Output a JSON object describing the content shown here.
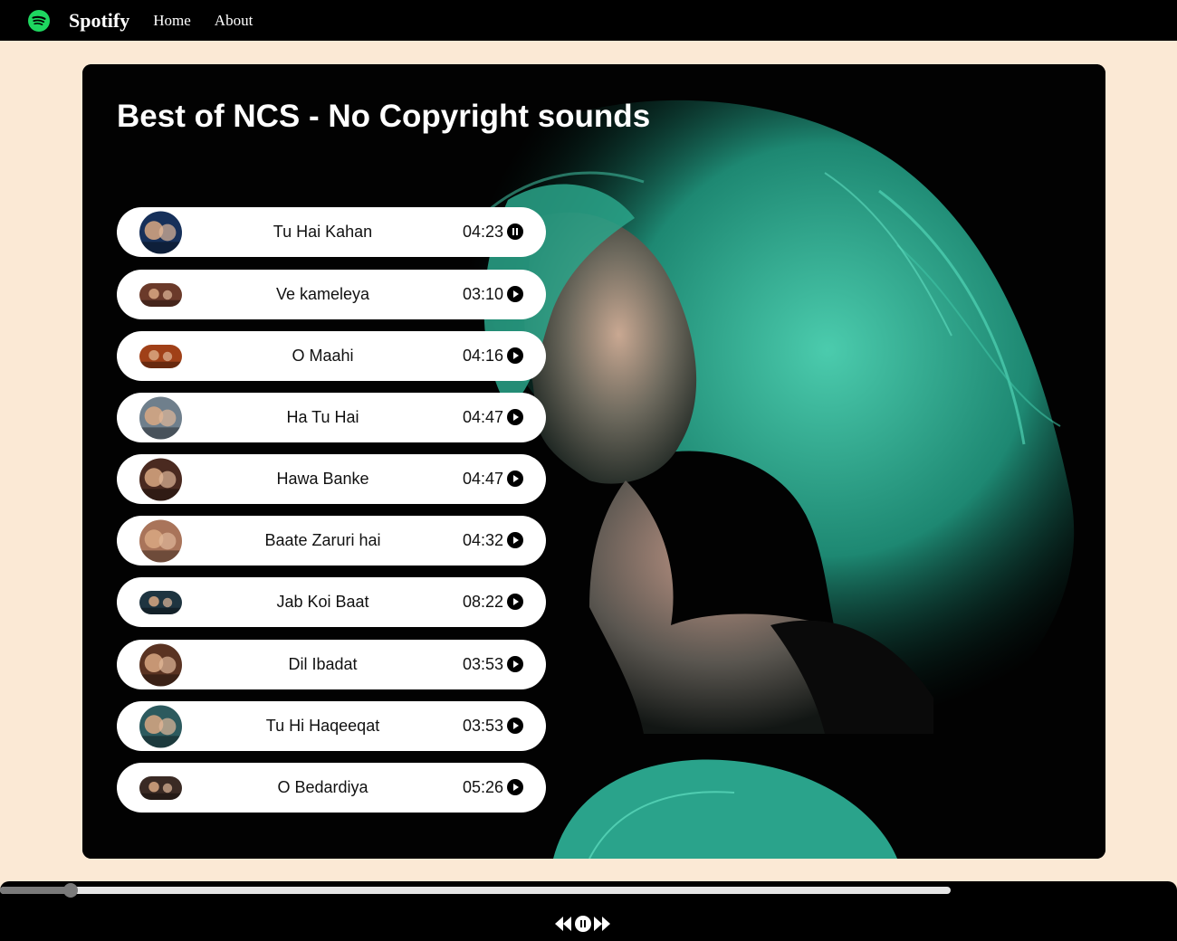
{
  "nav": {
    "brand": "Spotify",
    "logo_icon": "spotify-logo-icon",
    "links": [
      "Home",
      "About"
    ]
  },
  "playlist": {
    "title": "Best of NCS - No Copyright sounds",
    "background_icon": "green-hair-woman-illustration"
  },
  "songs": [
    {
      "name": "Tu Hai Kahan",
      "duration": "04:23",
      "state": "playing",
      "cover_color": "#16305a"
    },
    {
      "name": "Ve kameleya",
      "duration": "03:10",
      "state": "paused",
      "cover_color": "#6b3a2a"
    },
    {
      "name": "O Maahi",
      "duration": "04:16",
      "state": "paused",
      "cover_color": "#a04018"
    },
    {
      "name": "Ha Tu Hai",
      "duration": "04:47",
      "state": "paused",
      "cover_color": "#6f7f8c"
    },
    {
      "name": "Hawa Banke",
      "duration": "04:47",
      "state": "paused",
      "cover_color": "#4a2a20"
    },
    {
      "name": "Baate Zaruri hai",
      "duration": "04:32",
      "state": "paused",
      "cover_color": "#a9745a"
    },
    {
      "name": "Jab Koi Baat",
      "duration": "08:22",
      "state": "paused",
      "cover_color": "#1e3440"
    },
    {
      "name": "Dil Ibadat",
      "duration": "03:53",
      "state": "paused",
      "cover_color": "#5a3322"
    },
    {
      "name": "Tu Hi Haqeeqat",
      "duration": "03:53",
      "state": "paused",
      "cover_color": "#2c5a5e"
    },
    {
      "name": "O Bedardiya",
      "duration": "05:26",
      "state": "paused",
      "cover_color": "#3a2a24"
    }
  ],
  "player": {
    "progress_fraction": 0.074,
    "controls": [
      "previous-icon",
      "pause-icon",
      "next-icon"
    ],
    "state": "playing"
  },
  "colors": {
    "page_bg": "#fbe9d5",
    "accent_green": "#1ed760",
    "hair_teal": "#2fb59a"
  }
}
